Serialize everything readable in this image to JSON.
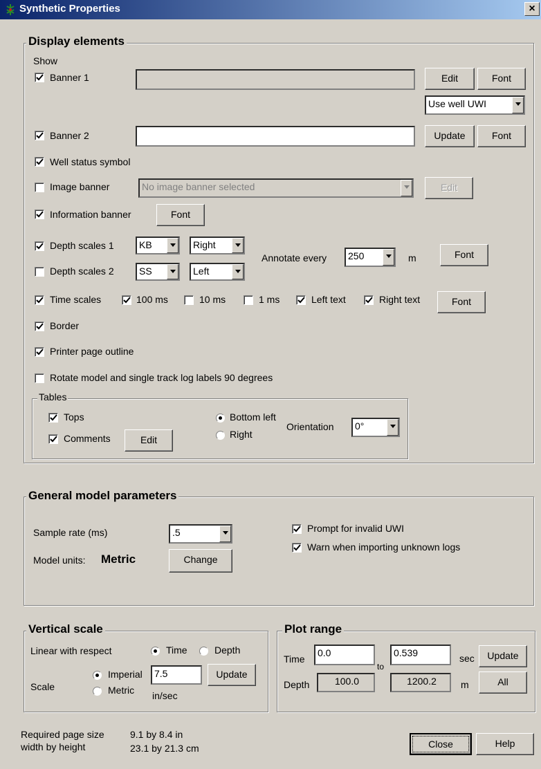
{
  "window": {
    "title": "Synthetic Properties"
  },
  "display": {
    "title": "Display elements",
    "show_label": "Show",
    "banner1": {
      "label": "Banner 1",
      "checked": true,
      "value": "",
      "edit": "Edit",
      "font": "Font",
      "uwi_option": "Use well UWI"
    },
    "banner2": {
      "label": "Banner 2",
      "checked": true,
      "value": "",
      "update": "Update",
      "font": "Font"
    },
    "well_status": {
      "label": "Well status symbol",
      "checked": true
    },
    "image_banner": {
      "label": "Image banner",
      "checked": false,
      "placeholder": "No image banner selected",
      "edit": "Edit"
    },
    "info_banner": {
      "label": "Information banner",
      "checked": true,
      "font": "Font"
    },
    "depth1": {
      "label": "Depth scales 1",
      "checked": true,
      "ref": "KB",
      "side": "Right"
    },
    "depth2": {
      "label": "Depth scales 2",
      "checked": false,
      "ref": "SS",
      "side": "Left"
    },
    "annotate": {
      "label": "Annotate every",
      "value": "250",
      "unit": "m",
      "font": "Font"
    },
    "time_scales": {
      "label": "Time scales",
      "checked": true,
      "opt100": "100 ms",
      "opt10": "10 ms",
      "opt1": "1 ms",
      "left_text": "Left text",
      "right_text": "Right text",
      "font": "Font"
    },
    "border": {
      "label": "Border",
      "checked": true
    },
    "printer_outline": {
      "label": "Printer page outline",
      "checked": true
    },
    "rotate": {
      "label": "Rotate model and single track log labels 90 degrees",
      "checked": false
    },
    "tables": {
      "title": "Tables",
      "tops": "Tops",
      "comments": "Comments",
      "edit": "Edit",
      "bottom_left": "Bottom left",
      "right": "Right",
      "orientation_label": "Orientation",
      "orientation_value": "0°"
    }
  },
  "general": {
    "title": "General model parameters",
    "sample_rate_label": "Sample rate (ms)",
    "sample_rate_value": ".5",
    "units_label": "Model units:",
    "units_value": "Metric",
    "change": "Change",
    "prompt_invalid": "Prompt for invalid UWI",
    "warn_unknown": "Warn when importing unknown logs"
  },
  "vertical": {
    "title": "Vertical scale",
    "linear_label": "Linear with respect",
    "time": "Time",
    "depth": "Depth",
    "scale_label": "Scale",
    "imperial": "Imperial",
    "metric": "Metric",
    "value": "7.5",
    "unit": "in/sec",
    "update": "Update"
  },
  "plot_range": {
    "title": "Plot range",
    "time_label": "Time",
    "time_from": "0.0",
    "to": "to",
    "time_to": "0.539",
    "time_unit": "sec",
    "update": "Update",
    "depth_label": "Depth",
    "depth_from": "100.0",
    "depth_to": "1200.2",
    "depth_unit": "m",
    "all": "All"
  },
  "footer": {
    "req_line1": "Required page size",
    "req_line2": "width by height",
    "size_in": "9.1 by 8.4 in",
    "size_cm": "23.1 by 21.3 cm",
    "close": "Close",
    "help": "Help"
  }
}
